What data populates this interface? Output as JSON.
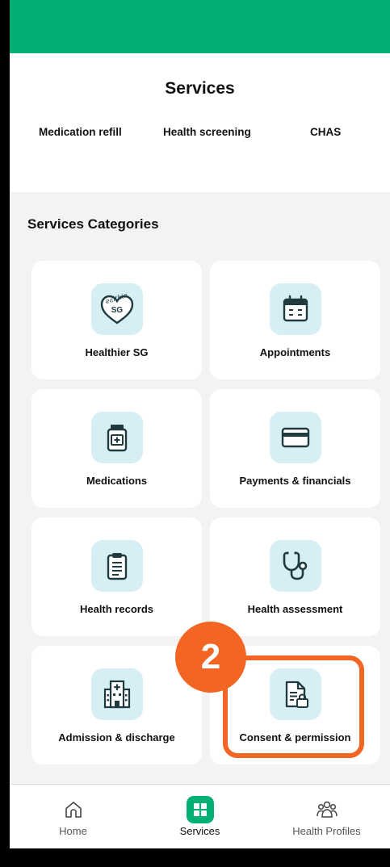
{
  "header": {
    "title": "Services"
  },
  "quick_links": [
    "Medication refill",
    "Health screening",
    "CHAS"
  ],
  "section_title": "Services Categories",
  "categories": [
    {
      "label": "Healthier SG",
      "icon": "healthier-sg-icon"
    },
    {
      "label": "Appointments",
      "icon": "calendar-icon"
    },
    {
      "label": "Medications",
      "icon": "medicine-bottle-icon"
    },
    {
      "label": "Payments & financials",
      "icon": "credit-card-icon"
    },
    {
      "label": "Health records",
      "icon": "clipboard-icon"
    },
    {
      "label": "Health assessment",
      "icon": "stethoscope-icon"
    },
    {
      "label": "Admission & discharge",
      "icon": "hospital-icon"
    },
    {
      "label": "Consent & permission",
      "icon": "document-lock-icon"
    }
  ],
  "healthier_sg_logo_text": "Healthier SG",
  "annotation": {
    "step": "2",
    "color": "#f26522"
  },
  "nav": [
    {
      "label": "Home",
      "icon": "home-icon"
    },
    {
      "label": "Services",
      "icon": "grid-icon"
    },
    {
      "label": "Health Profiles",
      "icon": "people-icon"
    }
  ],
  "colors": {
    "brand": "#04af73",
    "icon_bg": "#d7eef4",
    "icon_stroke": "#1f3b40",
    "highlight": "#f26522"
  }
}
